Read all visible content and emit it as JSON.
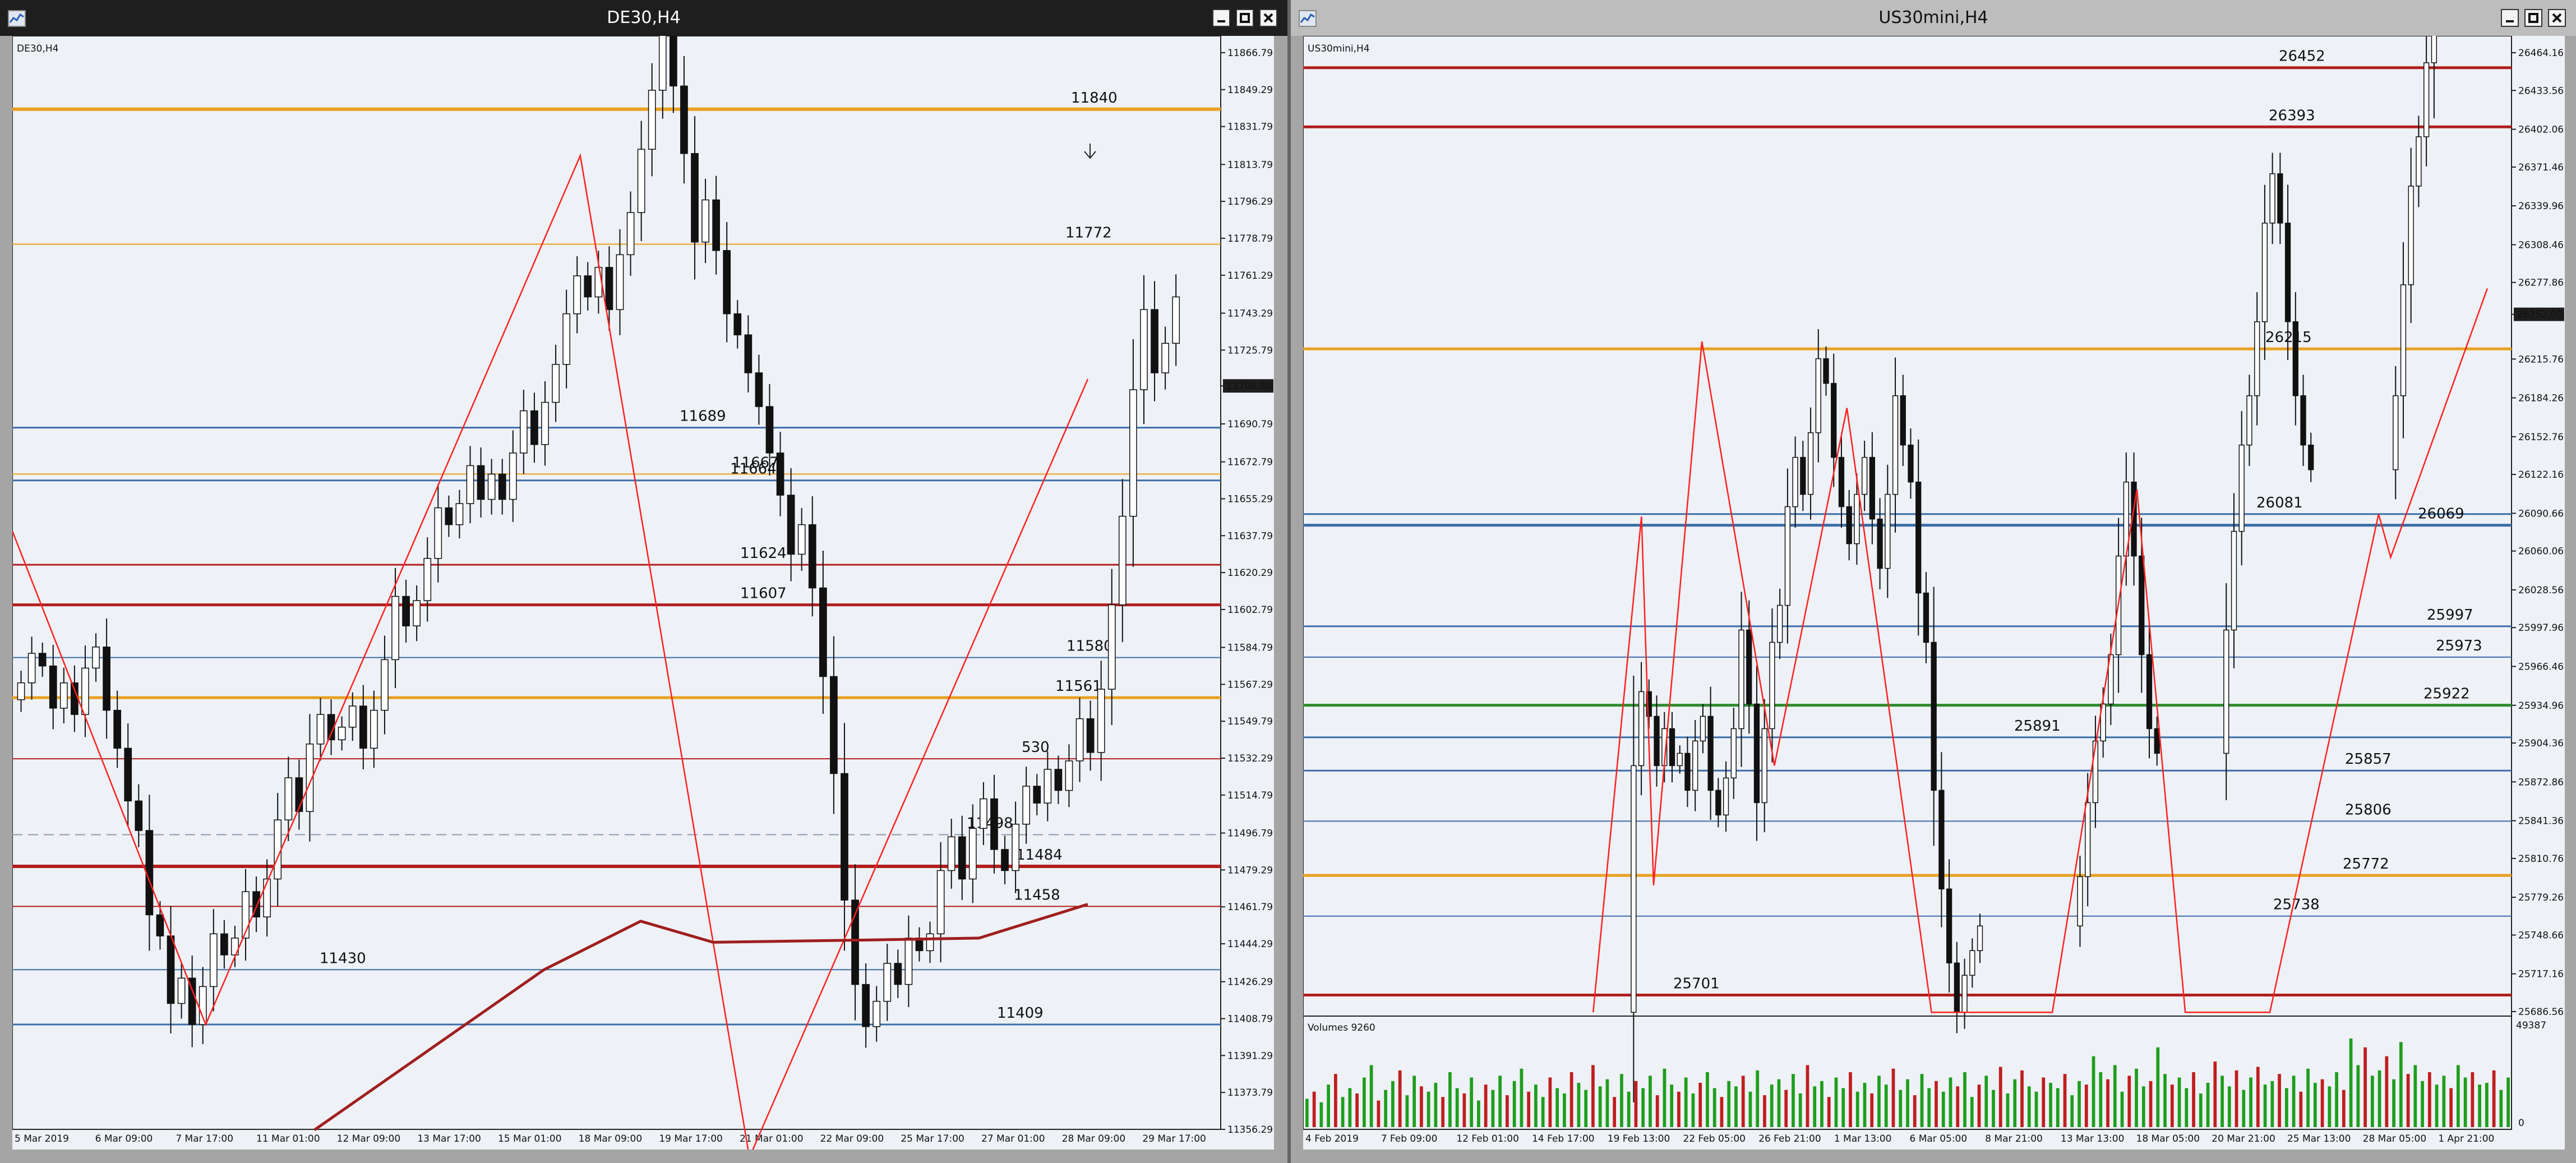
{
  "colors": {
    "desktop": "#646464",
    "plot_bg": "#eef1f6",
    "level_orange": "#e8a020",
    "level_red": "#b21e1e",
    "level_blue": "#3b6ea8",
    "level_green": "#2e8b2e",
    "zigzag": "#ff2020",
    "ma": "#a01e1e",
    "volume": "#1e9e1e"
  },
  "icons": {
    "window": "chart-window-icon",
    "minimize": "minimize-icon",
    "maximize": "restore-icon",
    "close": "close-icon",
    "arrow": "arrow-down-icon"
  },
  "windows": [
    {
      "title": "DE30,H4",
      "symbol_label": "DE30,H4",
      "price_labels": [
        "11866.79",
        "11849.29",
        "11831.79",
        "11813.79",
        "11796.29",
        "11778.79",
        "11761.29",
        "11743.29",
        "11725.79",
        "11708.80",
        "11690.79",
        "11672.79",
        "11655.29",
        "11637.79",
        "11620.29",
        "11602.79",
        "11584.79",
        "11567.29",
        "11549.79",
        "11532.29",
        "11514.79",
        "11496.79",
        "11479.29",
        "11461.79",
        "11444.29",
        "11426.29",
        "11408.79",
        "11391.29",
        "11373.79",
        "11356.29"
      ],
      "current_price": "11708.80",
      "time_labels": [
        "5 Mar 2019",
        "6 Mar 09:00",
        "7 Mar 17:00",
        "11 Mar 01:00",
        "12 Mar 09:00",
        "13 Mar 17:00",
        "15 Mar 01:00",
        "18 Mar 09:00",
        "19 Mar 17:00",
        "21 Mar 01:00",
        "22 Mar 09:00",
        "25 Mar 17:00",
        "27 Mar 01:00",
        "28 Mar 09:00",
        "29 Mar 17:00"
      ],
      "levels": [
        {
          "label": "11840",
          "value": 11840,
          "color": "orange",
          "width": 6
        },
        {
          "label": "11772",
          "value": 11776,
          "color": "orange",
          "width": 2
        },
        {
          "label": "11689",
          "value": 11689,
          "color": "blue",
          "width": 3
        },
        {
          "label": "11667",
          "value": 11667,
          "color": "orange",
          "width": 2
        },
        {
          "label": "11664",
          "value": 11664,
          "color": "blue",
          "width": 3
        },
        {
          "label": "11624",
          "value": 11624,
          "color": "red",
          "width": 3
        },
        {
          "label": "11607",
          "value": 11605,
          "color": "red",
          "width": 5
        },
        {
          "label": "11580",
          "value": 11580,
          "color": "blue",
          "width": 2
        },
        {
          "label": "11561",
          "value": 11561,
          "color": "orange",
          "width": 5
        },
        {
          "label": "530",
          "value": 11532,
          "color": "red",
          "width": 2
        },
        {
          "label": "11498",
          "value": 11496,
          "color": "dash",
          "width": 2
        },
        {
          "label": "11484",
          "value": 11481,
          "color": "red",
          "width": 6
        },
        {
          "label": "11458",
          "value": 11462,
          "color": "red",
          "width": 2
        },
        {
          "label": "11430",
          "value": 11432,
          "color": "blue",
          "width": 2
        },
        {
          "label": "11409",
          "value": 11406,
          "color": "blue",
          "width": 3
        }
      ],
      "zigzag": [
        [
          0,
          11640
        ],
        [
          0.16,
          11406
        ],
        [
          0.47,
          11818
        ],
        [
          0.61,
          11343
        ],
        [
          0.89,
          11712
        ]
      ],
      "series_start": 11560,
      "series_moves": [
        8,
        14,
        -6,
        -20,
        12,
        -15,
        22,
        10,
        -30,
        -18,
        -25,
        -14,
        -40,
        -10,
        -32,
        12,
        -22,
        18,
        25,
        -10,
        8,
        22,
        -12,
        18,
        28,
        20,
        -16,
        32,
        14,
        -12,
        6,
        10,
        -20,
        18,
        24,
        30,
        -14,
        12,
        20,
        24,
        -8,
        10,
        18,
        -16,
        12,
        -12,
        22,
        20,
        -16,
        20,
        18,
        24,
        18,
        -10,
        14,
        -20,
        26,
        20,
        30,
        28,
        30,
        -28,
        -32,
        -42,
        20,
        -24,
        -30,
        -10,
        -18,
        -16,
        -22,
        -20,
        -28,
        14,
        -30,
        -42,
        -46,
        -60,
        -40,
        -20,
        12,
        18,
        -10,
        22,
        -6,
        8,
        30,
        16,
        -20,
        24,
        14,
        -24,
        -10,
        22,
        18,
        -8,
        16,
        -10,
        14,
        20,
        -16,
        30,
        40,
        42,
        60,
        38,
        -30,
        14,
        22
      ],
      "ma_start": 11355,
      "ma_points": [
        [
          0.25,
          11356
        ],
        [
          0.44,
          11432
        ],
        [
          0.52,
          11455
        ],
        [
          0.58,
          11445
        ],
        [
          0.7,
          11446
        ],
        [
          0.8,
          11447
        ],
        [
          0.89,
          11463
        ]
      ]
    },
    {
      "title": "US30mini,H4",
      "symbol_label": "US30mini,H4",
      "price_labels": [
        "26464.16",
        "26433.56",
        "26402.06",
        "26371.46",
        "26339.96",
        "26308.46",
        "26277.86",
        "26252.00",
        "26215.76",
        "26184.26",
        "26152.76",
        "26122.16",
        "26090.66",
        "26060.06",
        "26028.56",
        "25997.96",
        "25966.46",
        "25934.96",
        "25904.36",
        "25872.86",
        "25841.36",
        "25810.76",
        "25779.26",
        "25748.66",
        "25717.16",
        "25686.56"
      ],
      "current_price": "26252.00",
      "time_labels": [
        "4 Feb 2019",
        "7 Feb 09:00",
        "12 Feb 01:00",
        "14 Feb 17:00",
        "19 Feb 13:00",
        "22 Feb 05:00",
        "26 Feb 21:00",
        "1 Mar 13:00",
        "6 Mar 05:00",
        "8 Mar 21:00",
        "13 Mar 13:00",
        "18 Mar 05:00",
        "20 Mar 21:00",
        "25 Mar 13:00",
        "28 Mar 05:00",
        "1 Apr 21:00"
      ],
      "levels": [
        {
          "label": "26452",
          "value": 26452,
          "color": "red",
          "width": 5
        },
        {
          "label": "26393",
          "value": 26404,
          "color": "red",
          "width": 5
        },
        {
          "label": "26215",
          "value": 26224,
          "color": "orange",
          "width": 5
        },
        {
          "label": "26081",
          "value": 26090,
          "color": "blue",
          "width": 3
        },
        {
          "label": "26069",
          "value": 26081,
          "color": "blue",
          "width": 5
        },
        {
          "label": "25997",
          "value": 25999,
          "color": "blue",
          "width": 3
        },
        {
          "label": "25973",
          "value": 25974,
          "color": "blue",
          "width": 2
        },
        {
          "label": "25922",
          "value": 25935,
          "color": "green",
          "width": 5
        },
        {
          "label": "25891",
          "value": 25909,
          "color": "blue",
          "width": 3
        },
        {
          "label": "25857",
          "value": 25882,
          "color": "blue",
          "width": 3
        },
        {
          "label": "25806",
          "value": 25841,
          "color": "blue",
          "width": 2
        },
        {
          "label": "25772",
          "value": 25797,
          "color": "orange",
          "width": 5
        },
        {
          "label": "25738",
          "value": 25764,
          "color": "blue",
          "width": 2
        },
        {
          "label": "25701",
          "value": 25700,
          "color": "red",
          "width": 5
        }
      ],
      "zigzag": [
        [
          0.24,
          25686
        ],
        [
          0.28,
          26088
        ],
        [
          0.29,
          25789
        ],
        [
          0.33,
          26230
        ],
        [
          0.39,
          25886
        ],
        [
          0.45,
          26176
        ],
        [
          0.52,
          25686
        ],
        [
          0.62,
          25686
        ],
        [
          0.69,
          26110
        ],
        [
          0.73,
          25686
        ],
        [
          0.8,
          25686
        ],
        [
          0.89,
          26090
        ],
        [
          0.9,
          26055
        ],
        [
          0.98,
          26273
        ]
      ],
      "series_start": 25686,
      "series_moves": [
        0,
        0,
        0,
        0,
        0,
        0,
        0,
        0,
        0,
        0,
        0,
        0,
        0,
        0,
        0,
        0,
        0,
        0,
        0,
        0,
        0,
        0,
        0,
        0,
        0,
        0,
        0,
        0,
        0,
        0,
        0,
        0,
        0,
        0,
        0,
        0,
        0,
        0,
        0,
        0,
        0,
        0,
        200,
        60,
        -20,
        -40,
        30,
        -30,
        10,
        -30,
        40,
        20,
        -60,
        -20,
        30,
        40,
        80,
        -60,
        -80,
        60,
        70,
        30,
        80,
        40,
        -30,
        50,
        60,
        -20,
        -60,
        -40,
        -30,
        40,
        30,
        -50,
        -40,
        60,
        80,
        -40,
        -30,
        -90,
        -40,
        -120,
        -80,
        -60,
        -40,
        30,
        20,
        20,
        0,
        0,
        0,
        0,
        0,
        0,
        0,
        0,
        0,
        0,
        0,
        0,
        40,
        60,
        50,
        30,
        40,
        80,
        60,
        -60,
        -80,
        -60,
        -20,
        0,
        0,
        0,
        0,
        0,
        0,
        0,
        0,
        100,
        80,
        70,
        40,
        60,
        80,
        40,
        -40,
        -80,
        -60,
        -40,
        -20,
        0,
        0,
        0,
        0,
        0,
        0,
        0,
        0,
        0,
        0,
        60,
        90,
        80,
        40,
        60,
        120,
        100,
        80,
        -80,
        -20,
        60,
        80
      ],
      "volume_label": "Volumes 9260",
      "volume_max": "49387",
      "volume_min": "0",
      "volumes": [
        32,
        40,
        28,
        48,
        60,
        34,
        44,
        38,
        56,
        70,
        30,
        42,
        52,
        64,
        36,
        58,
        46,
        40,
        50,
        34,
        62,
        44,
        38,
        56,
        30,
        48,
        42,
        58,
        36,
        52,
        66,
        40,
        48,
        34,
        56,
        44,
        38,
        62,
        50,
        42,
        70,
        46,
        54,
        34,
        60,
        40,
        52,
        44,
        58,
        36,
        66,
        48,
        40,
        56,
        38,
        50,
        62,
        44,
        34,
        52,
        46,
        58,
        40,
        64,
        36,
        48,
        54,
        42,
        60,
        38,
        70,
        46,
        52,
        34,
        56,
        44,
        62,
        40,
        50,
        38,
        58,
        48,
        66,
        42,
        54,
        36,
        60,
        44,
        52,
        40,
        56,
        46,
        62,
        34,
        48,
        58,
        42,
        68,
        38,
        54,
        64,
        46,
        40,
        56,
        50,
        44,
        60,
        36,
        52,
        48,
        80,
        62,
        54,
        70,
        40,
        58,
        66,
        46,
        52,
        90,
        60,
        48,
        56,
        44,
        62,
        38,
        50,
        74,
        58,
        46,
        64,
        42,
        56,
        68,
        48,
        52,
        60,
        44,
        58,
        40,
        66,
        50,
        54,
        46,
        62,
        42,
        100,
        70,
        90,
        58,
        64,
        80,
        54,
        96,
        60,
        70,
        52,
        62,
        48,
        58,
        44,
        70,
        56,
        62,
        48,
        50,
        64,
        42,
        56
      ]
    }
  ]
}
